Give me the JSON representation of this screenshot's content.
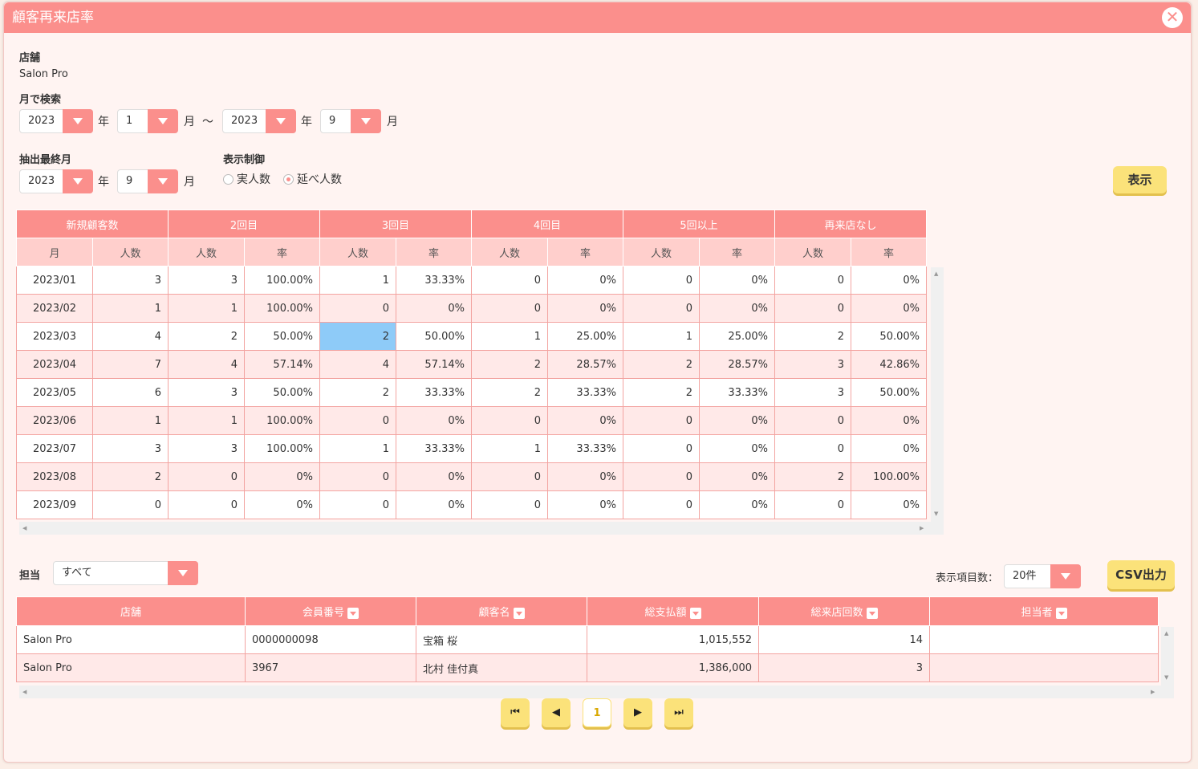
{
  "window": {
    "title": "顧客再来店率"
  },
  "store": {
    "label": "店舗",
    "value": "Salon Pro"
  },
  "month_search": {
    "label": "月で検索",
    "from_year": "2023",
    "year_unit": "年",
    "from_month": "1",
    "month_unit": "月",
    "tilde": "～",
    "to_year": "2023",
    "to_month": "9"
  },
  "extract_end": {
    "label": "抽出最終月",
    "year": "2023",
    "year_unit": "年",
    "month": "9",
    "month_unit": "月"
  },
  "display_control": {
    "label": "表示制御",
    "opt1": "実人数",
    "opt2": "延べ人数",
    "selected": "延べ人数"
  },
  "show_button": "表示",
  "rate_table": {
    "groups": [
      "新規顧客数",
      "2回目",
      "3回目",
      "4回目",
      "5回以上",
      "再来店なし"
    ],
    "subheaders": [
      "月",
      "人数",
      "人数",
      "率",
      "人数",
      "率",
      "人数",
      "率",
      "人数",
      "率",
      "人数",
      "率"
    ],
    "rows": [
      [
        "2023/01",
        "3",
        "3",
        "100.00%",
        "1",
        "33.33%",
        "0",
        "0%",
        "0",
        "0%",
        "0",
        "0%"
      ],
      [
        "2023/02",
        "1",
        "1",
        "100.00%",
        "0",
        "0%",
        "0",
        "0%",
        "0",
        "0%",
        "0",
        "0%"
      ],
      [
        "2023/03",
        "4",
        "2",
        "50.00%",
        "2",
        "50.00%",
        "1",
        "25.00%",
        "1",
        "25.00%",
        "2",
        "50.00%"
      ],
      [
        "2023/04",
        "7",
        "4",
        "57.14%",
        "4",
        "57.14%",
        "2",
        "28.57%",
        "2",
        "28.57%",
        "3",
        "42.86%"
      ],
      [
        "2023/05",
        "6",
        "3",
        "50.00%",
        "2",
        "33.33%",
        "2",
        "33.33%",
        "2",
        "33.33%",
        "3",
        "50.00%"
      ],
      [
        "2023/06",
        "1",
        "1",
        "100.00%",
        "0",
        "0%",
        "0",
        "0%",
        "0",
        "0%",
        "0",
        "0%"
      ],
      [
        "2023/07",
        "3",
        "3",
        "100.00%",
        "1",
        "33.33%",
        "1",
        "33.33%",
        "0",
        "0%",
        "0",
        "0%"
      ],
      [
        "2023/08",
        "2",
        "0",
        "0%",
        "0",
        "0%",
        "0",
        "0%",
        "0",
        "0%",
        "2",
        "100.00%"
      ],
      [
        "2023/09",
        "0",
        "0",
        "0%",
        "0",
        "0%",
        "0",
        "0%",
        "0",
        "0%",
        "0",
        "0%"
      ]
    ],
    "highlight_row": 2,
    "highlight_col": 4
  },
  "staff_filter": {
    "label": "担当",
    "value": "すべて"
  },
  "per_page": {
    "label": "表示項目数：",
    "value": "20件"
  },
  "csv_button": "CSV出力",
  "customer_table": {
    "headers": [
      {
        "label": "店舗",
        "sortable": false
      },
      {
        "label": "会員番号",
        "sortable": true
      },
      {
        "label": "顧客名",
        "sortable": true
      },
      {
        "label": "総支払額",
        "sortable": true
      },
      {
        "label": "総来店回数",
        "sortable": true
      },
      {
        "label": "担当者",
        "sortable": true
      }
    ],
    "rows": [
      [
        "Salon Pro",
        "0000000098",
        "宝箱 桜",
        "1,015,552",
        "14",
        ""
      ],
      [
        "Salon Pro",
        "3967",
        "北村 佳付真",
        "1,386,000",
        "3",
        ""
      ]
    ]
  },
  "pagination": {
    "current": "1"
  },
  "colors": {
    "accent": "#fb8f8c",
    "accent_light": "#ffcfcc",
    "button": "#fbe27a",
    "highlight": "#8ecbf8"
  }
}
